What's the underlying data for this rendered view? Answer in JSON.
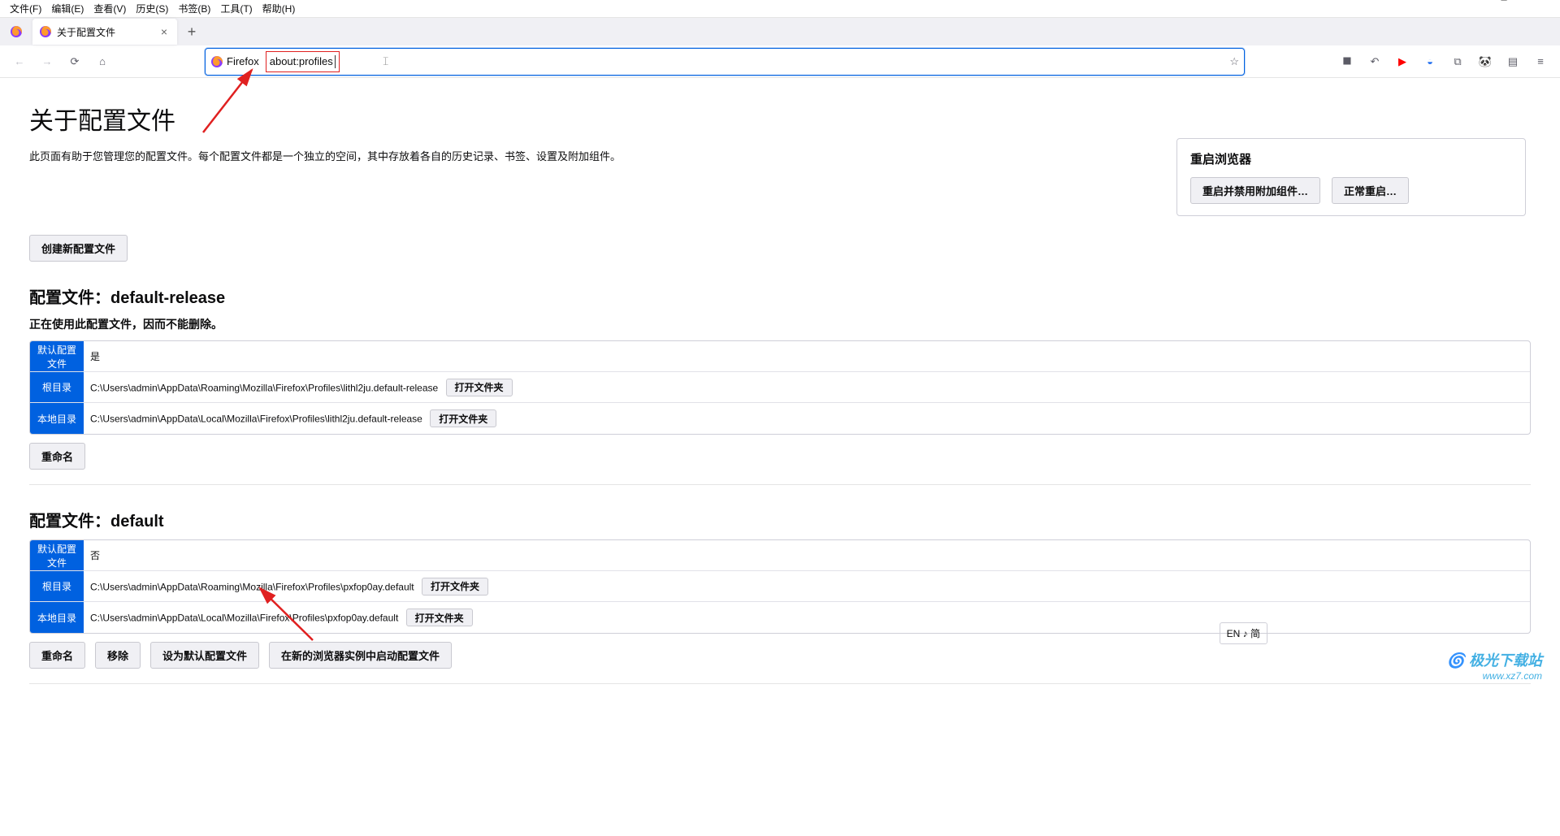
{
  "menubar": [
    "文件(F)",
    "编辑(E)",
    "查看(V)",
    "历史(S)",
    "书签(B)",
    "工具(T)",
    "帮助(H)"
  ],
  "tab": {
    "title": "关于配置文件"
  },
  "url": {
    "badge": "Firefox",
    "value": "about:profiles"
  },
  "page": {
    "title": "关于配置文件",
    "desc": "此页面有助于您管理您的配置文件。每个配置文件都是一个独立的空间，其中存放着各自的历史记录、书签、设置及附加组件。"
  },
  "restart": {
    "title": "重启浏览器",
    "disable_addons": "重启并禁用附加组件…",
    "normal": "正常重启…"
  },
  "create_btn": "创建新配置文件",
  "labels": {
    "default": "默认配置文件",
    "root": "根目录",
    "local": "本地目录"
  },
  "open_folder": "打开文件夹",
  "profile1": {
    "heading": "配置文件：default-release",
    "note": "正在使用此配置文件，因而不能删除。",
    "default": "是",
    "root": "C:\\Users\\admin\\AppData\\Roaming\\Mozilla\\Firefox\\Profiles\\lithl2ju.default-release",
    "local": "C:\\Users\\admin\\AppData\\Local\\Mozilla\\Firefox\\Profiles\\lithl2ju.default-release",
    "rename": "重命名"
  },
  "profile2": {
    "heading": "配置文件：default",
    "default": "否",
    "root": "C:\\Users\\admin\\AppData\\Roaming\\Mozilla\\Firefox\\Profiles\\pxfop0ay.default",
    "local": "C:\\Users\\admin\\AppData\\Local\\Mozilla\\Firefox\\Profiles\\pxfop0ay.default",
    "rename": "重命名",
    "remove": "移除",
    "set_default": "设为默认配置文件",
    "launch": "在新的浏览器实例中启动配置文件"
  },
  "ime": "EN ♪ 简",
  "watermark": {
    "name": "极光下载站",
    "url": "www.xz7.com"
  }
}
